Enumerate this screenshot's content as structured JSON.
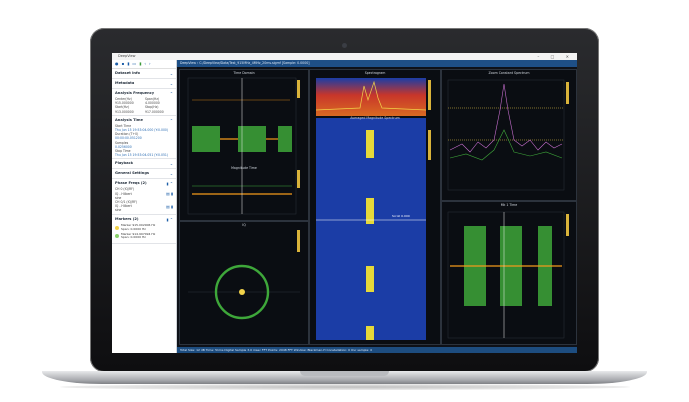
{
  "window": {
    "title": "DeepView",
    "controls": "–  □  ✕"
  },
  "toolbar": {
    "icons": [
      "play-icon",
      "file-icon",
      "save-icon",
      "folder-icon",
      "export-icon",
      "back-icon",
      "forward-icon"
    ]
  },
  "sidebar": {
    "dataset_info": "Dataset Info",
    "metadata": "Metadata",
    "analysis_frequency": {
      "header": "Analysis Frequency",
      "labels": [
        "Center(Hz)",
        "Span(Hz)",
        "Start(Hz)",
        "Stop(Hz)"
      ],
      "values": [
        "915.000000",
        "4.000000",
        "913.000000",
        "917.000000"
      ]
    },
    "analysis_time": {
      "header": "Analysis Time",
      "start_label": "Start Time",
      "start_value": "Thu Jun 15 19:53:04.000 (Y:0.000)",
      "duration_label": "Duration (T+0)",
      "duration_value": "00:00:00.051200",
      "samples_label": "Samples",
      "samples_value": "0.0256000",
      "stop_label": "Stop Time",
      "stop_value": "Thu Jun 15 19:53:04.051 (Y:0.051)"
    },
    "playback": "Playback",
    "general_settings": "General Settings",
    "phase_freqs": {
      "header": "Phase Freqs",
      "count": "(2)",
      "items": [
        {
          "line1": "CH 0 (IQ/RF)",
          "line2": "IQ - Hilbert",
          "line3": "sine"
        },
        {
          "line1": "CH 0/1 (IQ/RF)",
          "line2": "IQ - Hilbert",
          "line3": "sine"
        }
      ]
    },
    "markers": {
      "header": "Markers",
      "count": "(2)",
      "items": [
        {
          "label": "Marker 915.002906 Hz",
          "sub": "Span: 0.0000 Hz",
          "color": "#f2d24a"
        },
        {
          "label": "Marker 914.997094 Hz",
          "sub": "Span: 0.0000 Hz",
          "color": "#8ad26b"
        }
      ]
    }
  },
  "topbar": {
    "path": "DeepView  ›  C:/DeepView/Data/Test_915MHz_4MHz_20ms.sigmf  [Sample: 0.0000]"
  },
  "panels": {
    "time_domain": "Time Domain",
    "magnitude_time": "Magnitude Time",
    "iq": "IQ",
    "spectrogram": "Spectrogram",
    "averaged_spectrum": "Averaged Magnitude Spectrum",
    "zoomed_spectrum": "Zoom Constant Spectrum",
    "zoom_time": "Mk 1 Time",
    "scroll_label": "Scroll 0.000"
  },
  "status": {
    "text": "Total Size: 12 dB   Time: 51ms   Digital Sample 3.0 msec   FFT Points: 2048   FFT Window: Blackman-H   Constellation: 0   Ovr sample: 0"
  },
  "colors": {
    "accent": "#1e4f86",
    "trace_green": "#3ea73a",
    "trace_orange": "#f39a1b",
    "spec_blue": "#1b3da6"
  }
}
